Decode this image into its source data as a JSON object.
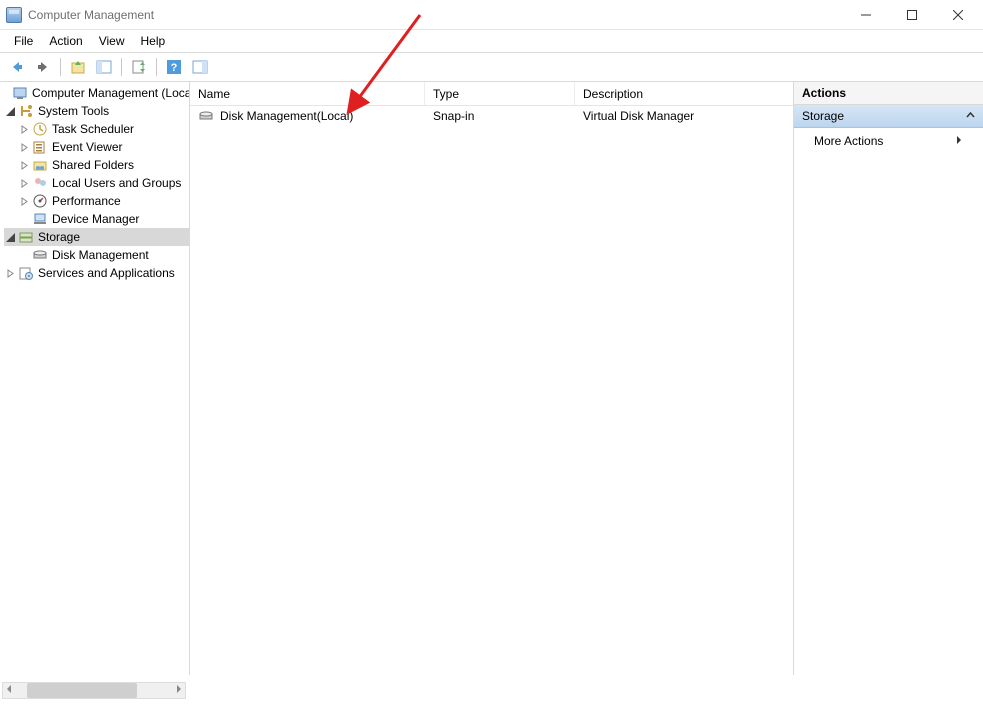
{
  "window": {
    "title": "Computer Management"
  },
  "menu": {
    "file": "File",
    "action": "Action",
    "view": "View",
    "help": "Help"
  },
  "tree": {
    "root": "Computer Management (Local)",
    "system_tools": "System Tools",
    "task_scheduler": "Task Scheduler",
    "event_viewer": "Event Viewer",
    "shared_folders": "Shared Folders",
    "local_users_groups": "Local Users and Groups",
    "performance": "Performance",
    "device_manager": "Device Manager",
    "storage": "Storage",
    "disk_management": "Disk Management",
    "services_applications": "Services and Applications"
  },
  "columns": {
    "name": "Name",
    "type": "Type",
    "description": "Description"
  },
  "list": {
    "item0": {
      "name": "Disk Management(Local)",
      "type": "Snap-in",
      "description": "Virtual Disk Manager"
    }
  },
  "actions": {
    "header": "Actions",
    "context": "Storage",
    "more": "More Actions"
  }
}
